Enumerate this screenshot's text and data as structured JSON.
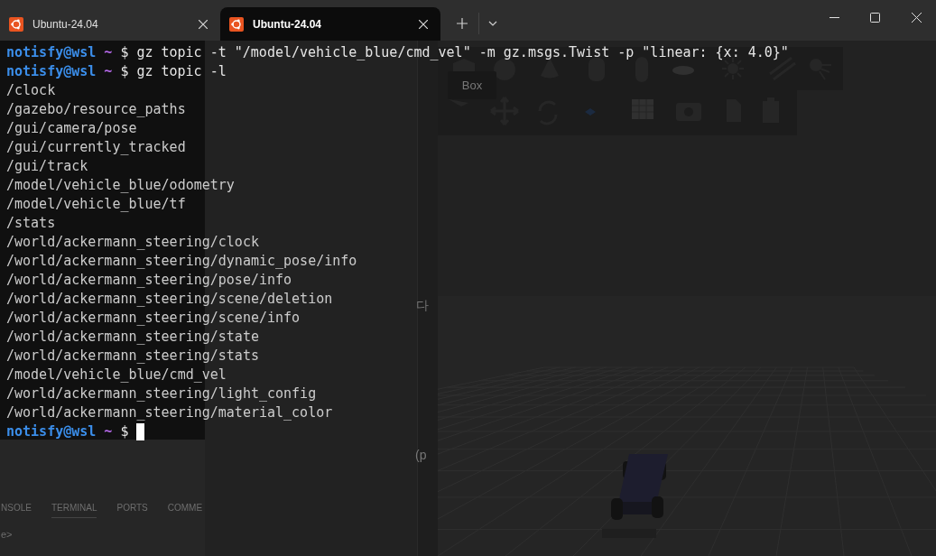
{
  "tabs": [
    {
      "title": "Ubuntu-24.04",
      "selected": false
    },
    {
      "title": "Ubuntu-24.04",
      "selected": true
    }
  ],
  "terminal": {
    "lines": [
      {
        "kind": "prompt",
        "user": "notisfy@wsl",
        "dir": "~",
        "symbol": "$",
        "command": "gz topic -t \"/model/vehicle_blue/cmd_vel\" -m gz.msgs.Twist -p \"linear: {x: 4.0}\""
      },
      {
        "kind": "prompt",
        "user": "notisfy@wsl",
        "dir": "~",
        "symbol": "$",
        "command": "gz topic -l"
      },
      {
        "kind": "output",
        "text": "/clock"
      },
      {
        "kind": "output",
        "text": "/gazebo/resource_paths"
      },
      {
        "kind": "output",
        "text": "/gui/camera/pose"
      },
      {
        "kind": "output",
        "text": "/gui/currently_tracked"
      },
      {
        "kind": "output",
        "text": "/gui/track"
      },
      {
        "kind": "output",
        "text": "/model/vehicle_blue/odometry"
      },
      {
        "kind": "output",
        "text": "/model/vehicle_blue/tf"
      },
      {
        "kind": "output",
        "text": "/stats"
      },
      {
        "kind": "output",
        "text": "/world/ackermann_steering/clock"
      },
      {
        "kind": "output",
        "text": "/world/ackermann_steering/dynamic_pose/info"
      },
      {
        "kind": "output",
        "text": "/world/ackermann_steering/pose/info"
      },
      {
        "kind": "output",
        "text": "/world/ackermann_steering/scene/deletion"
      },
      {
        "kind": "output",
        "text": "/world/ackermann_steering/scene/info"
      },
      {
        "kind": "output",
        "text": "/world/ackermann_steering/state"
      },
      {
        "kind": "output",
        "text": "/world/ackermann_steering/stats"
      },
      {
        "kind": "output",
        "text": "/model/vehicle_blue/cmd_vel"
      },
      {
        "kind": "output",
        "text": "/world/ackermann_steering/light_config"
      },
      {
        "kind": "output",
        "text": "/world/ackermann_steering/material_color"
      },
      {
        "kind": "prompt",
        "user": "notisfy@wsl",
        "dir": "~",
        "symbol": "$",
        "cursor": true
      }
    ]
  },
  "background": {
    "toolbar_tooltip": "Box",
    "panel_tabs": [
      {
        "label": "NSOLE",
        "selected": false
      },
      {
        "label": "TERMINAL",
        "selected": true
      },
      {
        "label": "PORTS",
        "selected": false
      },
      {
        "label": "COMME",
        "selected": false
      }
    ],
    "panel_prompt": "e>",
    "fragments": [
      "다",
      "(p"
    ]
  }
}
